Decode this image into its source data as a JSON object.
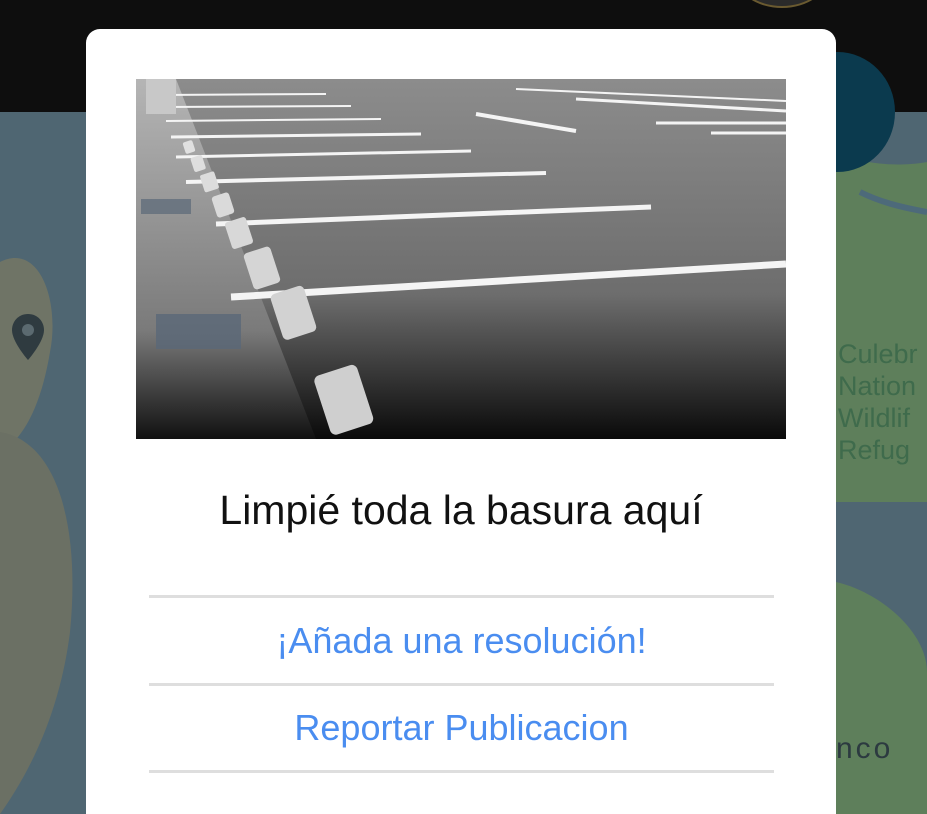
{
  "post": {
    "title": "Limpié toda la basura aquí",
    "image_alt": "parking-lot-photo"
  },
  "actions": {
    "add_resolution": "¡Añada una resolución!",
    "report_post": "Reportar Publicacion"
  },
  "map": {
    "refuge_label_lines": [
      "Culebr",
      "Nation",
      "Wildlif",
      "Refug"
    ],
    "place_label": "nco"
  },
  "colors": {
    "link": "#4a8df0",
    "dialog_bg": "#ffffff",
    "topbar_bg": "#0e0e0e",
    "divider": "#dedede"
  }
}
